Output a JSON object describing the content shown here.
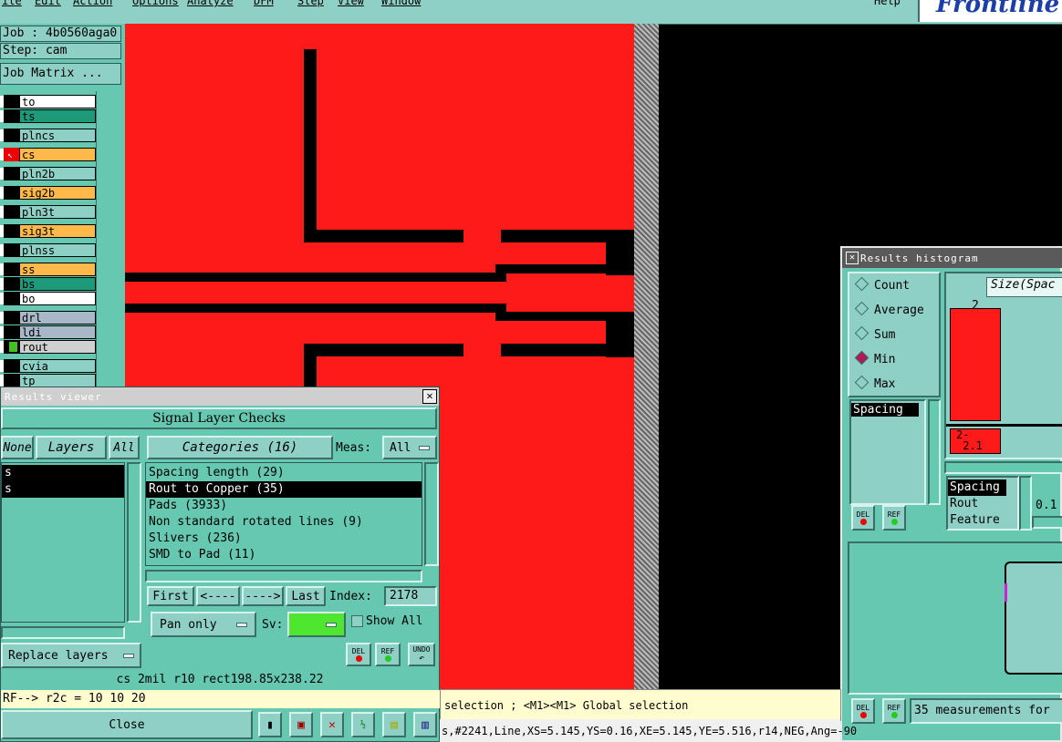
{
  "colors": {
    "panel": "#66c8b0",
    "button": "#8fd0c6",
    "copper": "#ff1a1a",
    "trace": "#000000"
  },
  "menubar": {
    "items": [
      "ile",
      "Edit",
      "Action",
      "Options",
      "Analyze",
      "DFM",
      "Step",
      "View",
      "Window"
    ],
    "help": "Help",
    "logo": "Frontline"
  },
  "left": {
    "job": "Job : 4b0560aga0",
    "step": "Step: cam",
    "job_matrix": "Job Matrix ...",
    "layers": [
      {
        "name": "to",
        "bg": "#ffffff"
      },
      {
        "name": "ts",
        "bg": "#1e9a7a"
      },
      {
        "name": "plncs",
        "bg": "#8fd0c6"
      },
      {
        "name": "cs",
        "bg": "#ffb84a"
      },
      {
        "name": "pln2b",
        "bg": "#8fd0c6"
      },
      {
        "name": "sig2b",
        "bg": "#ffb84a"
      },
      {
        "name": "pln3t",
        "bg": "#8fd0c6"
      },
      {
        "name": "sig3t",
        "bg": "#ffb84a"
      },
      {
        "name": "plnss",
        "bg": "#8fd0c6"
      },
      {
        "name": "ss",
        "bg": "#ffb84a"
      },
      {
        "name": "bs",
        "bg": "#1e9a7a"
      },
      {
        "name": "bo",
        "bg": "#ffffff"
      },
      {
        "name": "drl",
        "bg": "#a8b8c8"
      },
      {
        "name": "ldi",
        "bg": "#a8b8c8"
      },
      {
        "name": "rout",
        "bg": "#d0d0d0"
      },
      {
        "name": "cvia",
        "bg": "#8fd0c6"
      },
      {
        "name": "tp",
        "bg": "#8fd0c6"
      }
    ]
  },
  "results_viewer": {
    "title": "Results viewer",
    "header": "Signal Layer Checks",
    "none_btn": "None",
    "layers_btn": "Layers",
    "all_btn": "All",
    "layer_items": [
      "s",
      "s"
    ],
    "categories_btn": "Categories (16)",
    "meas_label": "Meas:",
    "meas_value": "All",
    "categories": [
      "Spacing length (29)",
      "Rout to Copper (35)",
      "Pads (3933)",
      "Non standard rotated lines (9)",
      "Slivers (236)",
      "SMD to Pad (11)"
    ],
    "selected_category": 1,
    "first": "First",
    "prev": "<----",
    "next": "---->",
    "last": "Last",
    "index_label": "Index:",
    "index_value": "2178",
    "pan_mode": "Pan only",
    "sv_label": "Sv:",
    "show_all": "Show All",
    "replace_layers": "Replace layers",
    "del": "DEL",
    "ref": "REF",
    "undo": "UNDO",
    "info_line": "cs 2mil  r10  rect198.85x238.22",
    "ref_line": "RF--> r2c = 10 10 20",
    "close": "Close"
  },
  "histogram": {
    "title": "Results histogram",
    "options": [
      "Count",
      "Average",
      "Sum",
      "Min",
      "Max"
    ],
    "selected": 3,
    "size_label": "Size(Spac",
    "bar_label": "2",
    "bar_range": "2-\n 2.1",
    "left_list": [
      "Spacing"
    ],
    "type_list": [
      "Spacing",
      "Rout",
      "Feature"
    ],
    "scale_value": "0.1",
    "del": "DEL",
    "ref": "REF",
    "measurements": "35 measurements for"
  },
  "status": {
    "message": "selection ; <M1><M1> Global selection",
    "coords": "s,#2241,Line,XS=5.145,YS=0.16,XE=5.145,YE=5.516,r14,NEG,Ang=-90"
  }
}
